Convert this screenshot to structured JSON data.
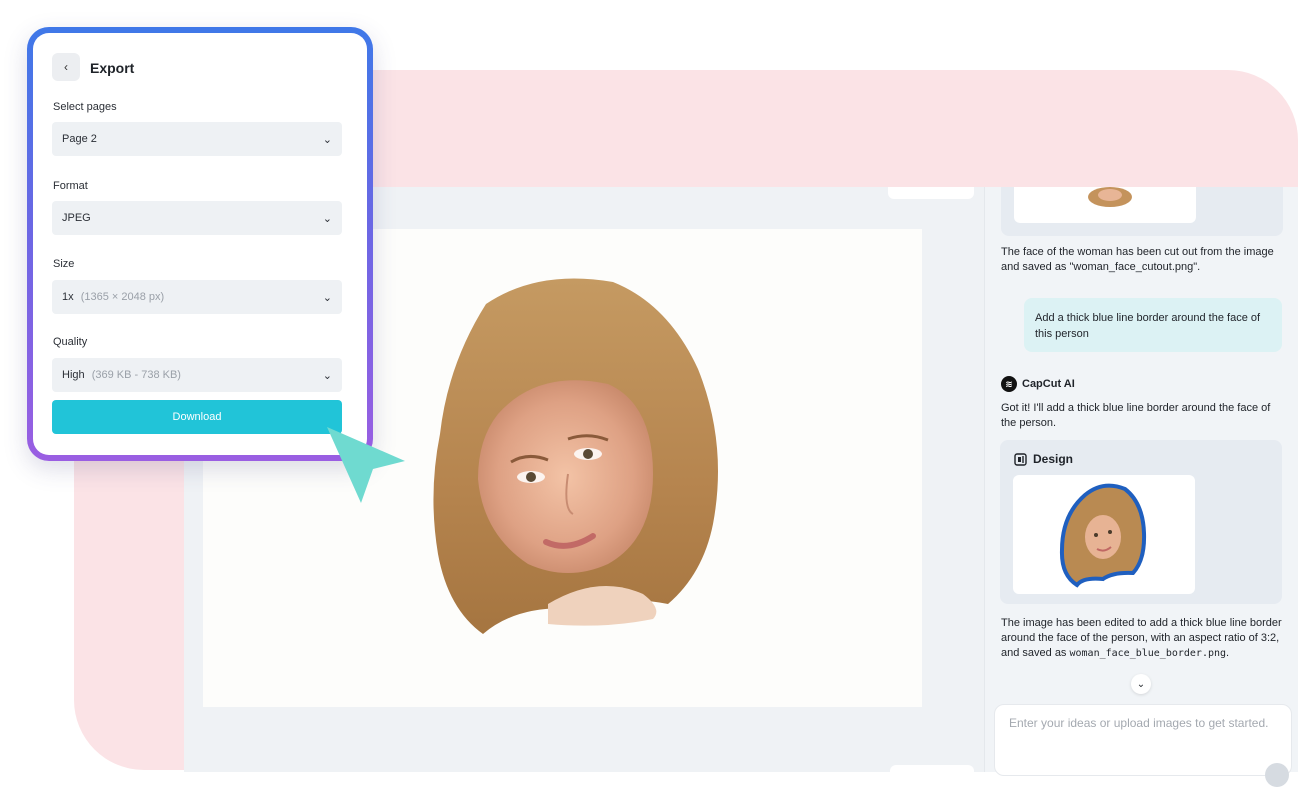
{
  "export_panel": {
    "title": "Export",
    "select_pages_label": "Select pages",
    "select_pages_value": "Page 2",
    "format_label": "Format",
    "format_value": "JPEG",
    "size_label": "Size",
    "size_value": "1x",
    "size_hint": "(1365 × 2048 px)",
    "quality_label": "Quality",
    "quality_value": "High",
    "quality_hint": "(369 KB - 738 KB)",
    "download_label": "Download"
  },
  "chat": {
    "msg_cutout": "The face of the woman has been cut out from the image and saved as \"woman_face_cutout.png\".",
    "user_message": "Add a thick blue line border around the face of this person",
    "ai_name": "CapCut AI",
    "ai_reply": "Got it! I'll add a thick blue line border around the face of the person.",
    "design_label": "Design",
    "result_text": "The image has been edited to add a thick blue line border around the face of the person, with an aspect ratio of 3:2, and saved as",
    "result_filename": "woman_face_blue_border.png",
    "result_end": ".",
    "input_placeholder": "Enter your ideas or upload images to get started."
  },
  "colors": {
    "accent": "#21c4d8",
    "background_pink": "#fbe3e6",
    "panel_gradient_top": "#3f78e8",
    "panel_gradient_bottom": "#9a5ee2",
    "border_blue": "#1f5fbf"
  },
  "icons": [
    "back-chevron-icon",
    "chevron-down-icon",
    "capcut-logo-icon",
    "design-icon",
    "cursor-arrow-icon",
    "scroll-down-icon"
  ]
}
